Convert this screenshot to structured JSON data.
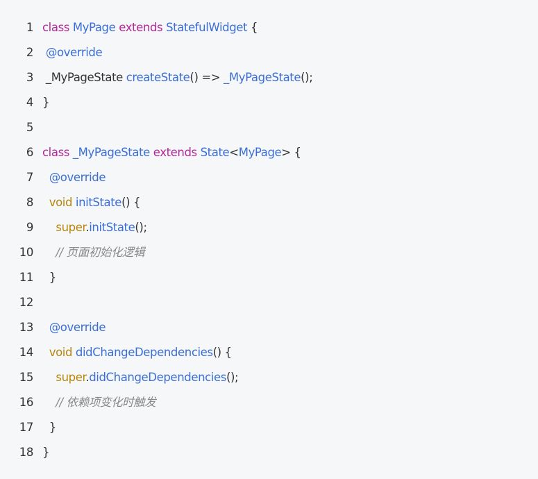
{
  "code": {
    "lines": [
      {
        "n": "1",
        "tokens": [
          {
            "t": "class",
            "s": "k"
          },
          {
            "t": " ",
            "s": "p"
          },
          {
            "t": "MyPage",
            "s": "t"
          },
          {
            "t": " ",
            "s": "p"
          },
          {
            "t": "extends",
            "s": "k"
          },
          {
            "t": " ",
            "s": "p"
          },
          {
            "t": "StatefulWidget",
            "s": "t"
          },
          {
            "t": " {",
            "s": "p"
          }
        ]
      },
      {
        "n": "2",
        "tokens": [
          {
            "t": " ",
            "s": "p"
          },
          {
            "t": "@override",
            "s": "t"
          }
        ]
      },
      {
        "n": "3",
        "tokens": [
          {
            "t": " _MyPageState ",
            "s": "p"
          },
          {
            "t": "createState",
            "s": "t"
          },
          {
            "t": "() => ",
            "s": "p"
          },
          {
            "t": "_MyPageState",
            "s": "t"
          },
          {
            "t": "();",
            "s": "p"
          }
        ]
      },
      {
        "n": "4",
        "tokens": [
          {
            "t": "}",
            "s": "p"
          }
        ]
      },
      {
        "n": "5",
        "tokens": []
      },
      {
        "n": "6",
        "tokens": [
          {
            "t": "class",
            "s": "k"
          },
          {
            "t": " ",
            "s": "p"
          },
          {
            "t": "_MyPageState",
            "s": "t"
          },
          {
            "t": " ",
            "s": "p"
          },
          {
            "t": "extends",
            "s": "k"
          },
          {
            "t": " ",
            "s": "p"
          },
          {
            "t": "State",
            "s": "t"
          },
          {
            "t": "<",
            "s": "p"
          },
          {
            "t": "MyPage",
            "s": "t"
          },
          {
            "t": "> {",
            "s": "p"
          }
        ]
      },
      {
        "n": "7",
        "tokens": [
          {
            "t": "  ",
            "s": "p"
          },
          {
            "t": "@override",
            "s": "t"
          }
        ]
      },
      {
        "n": "8",
        "tokens": [
          {
            "t": "  ",
            "s": "p"
          },
          {
            "t": "void",
            "s": "v"
          },
          {
            "t": " ",
            "s": "p"
          },
          {
            "t": "initState",
            "s": "t"
          },
          {
            "t": "() {",
            "s": "p"
          }
        ]
      },
      {
        "n": "9",
        "tokens": [
          {
            "t": "    ",
            "s": "p"
          },
          {
            "t": "super",
            "s": "v"
          },
          {
            "t": ".",
            "s": "p"
          },
          {
            "t": "initState",
            "s": "t"
          },
          {
            "t": "();",
            "s": "p"
          }
        ]
      },
      {
        "n": "10",
        "tokens": [
          {
            "t": "    ",
            "s": "p"
          },
          {
            "t": "// 页面初始化逻辑",
            "s": "c"
          }
        ]
      },
      {
        "n": "11",
        "tokens": [
          {
            "t": "  }",
            "s": "p"
          }
        ]
      },
      {
        "n": "12",
        "tokens": []
      },
      {
        "n": "13",
        "tokens": [
          {
            "t": "  ",
            "s": "p"
          },
          {
            "t": "@override",
            "s": "t"
          }
        ]
      },
      {
        "n": "14",
        "tokens": [
          {
            "t": "  ",
            "s": "p"
          },
          {
            "t": "void",
            "s": "v"
          },
          {
            "t": " ",
            "s": "p"
          },
          {
            "t": "didChangeDependencies",
            "s": "t"
          },
          {
            "t": "() {",
            "s": "p"
          }
        ]
      },
      {
        "n": "15",
        "tokens": [
          {
            "t": "    ",
            "s": "p"
          },
          {
            "t": "super",
            "s": "v"
          },
          {
            "t": ".",
            "s": "p"
          },
          {
            "t": "didChangeDependencies",
            "s": "t"
          },
          {
            "t": "();",
            "s": "p"
          }
        ]
      },
      {
        "n": "16",
        "tokens": [
          {
            "t": "    ",
            "s": "p"
          },
          {
            "t": "// 依赖项变化时触发",
            "s": "c"
          }
        ]
      },
      {
        "n": "17",
        "tokens": [
          {
            "t": "  }",
            "s": "p"
          }
        ]
      },
      {
        "n": "18",
        "tokens": [
          {
            "t": "}",
            "s": "p"
          }
        ]
      }
    ]
  },
  "colors": {
    "background": "#f6f7f9",
    "keyword": "#b5279b",
    "type": "#3b6fd6",
    "builtin": "#b8860b",
    "comment": "#8a8a8a",
    "plain": "#333333"
  }
}
